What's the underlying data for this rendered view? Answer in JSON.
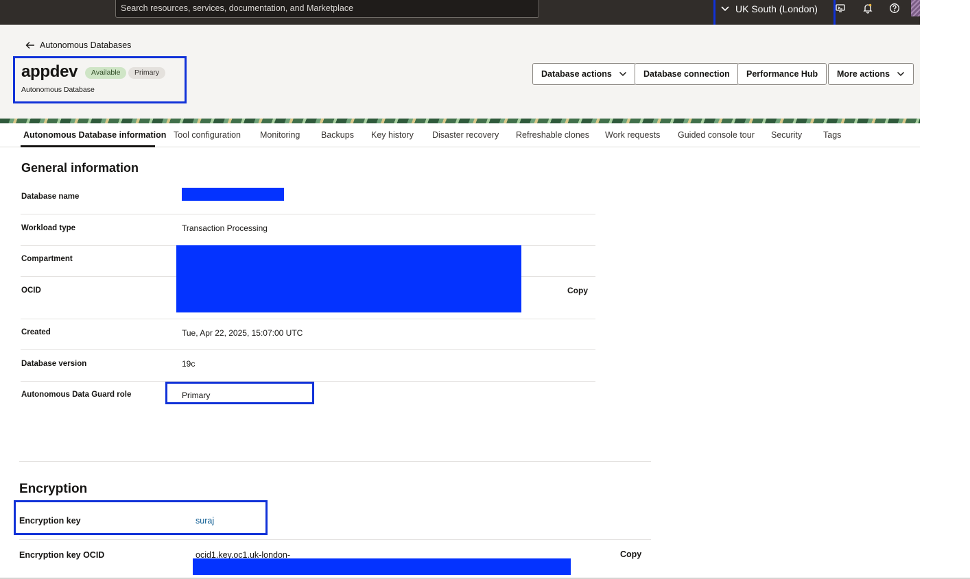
{
  "topbar": {
    "search_placeholder": "Search resources, services, documentation, and Marketplace",
    "region": "UK South (London)",
    "icons": [
      "cloud-shell-icon",
      "bell-icon",
      "help-icon"
    ]
  },
  "header": {
    "back_label": "Autonomous Databases",
    "title": "appdev",
    "status_badge": "Available",
    "role_badge": "Primary",
    "subtitle": "Autonomous Database",
    "actions": {
      "database_actions": "Database actions",
      "database_connection": "Database connection",
      "performance_hub": "Performance Hub",
      "more_actions": "More actions"
    }
  },
  "tabs": [
    "Autonomous Database information",
    "Tool configuration",
    "Monitoring",
    "Backups",
    "Key history",
    "Disaster recovery",
    "Refreshable clones",
    "Work requests",
    "Guided console tour",
    "Security",
    "Tags"
  ],
  "general": {
    "heading": "General information",
    "rows": {
      "database_name": {
        "label": "Database name",
        "value": ""
      },
      "workload_type": {
        "label": "Workload type",
        "value": "Transaction Processing"
      },
      "compartment": {
        "label": "Compartment",
        "value": ""
      },
      "ocid": {
        "label": "OCID",
        "value": "",
        "copy": "Copy"
      },
      "created": {
        "label": "Created",
        "value": "Tue, Apr 22, 2025, 15:07:00 UTC"
      },
      "database_version": {
        "label": "Database version",
        "value": "19c"
      },
      "data_guard_role": {
        "label": "Autonomous Data Guard role",
        "value": "Primary"
      }
    }
  },
  "encryption": {
    "heading": "Encryption",
    "key": {
      "label": "Encryption key",
      "value": "suraj"
    },
    "key_ocid": {
      "label": "Encryption key OCID",
      "value": "ocid1.key.oc1.uk-london-",
      "copy": "Copy"
    }
  },
  "colors": {
    "topbar": "#312d2a",
    "highlight_box": "#1132d8",
    "redaction": "#0433ff",
    "badge_available": "#cfe5c6",
    "link": "#0b5b92"
  }
}
